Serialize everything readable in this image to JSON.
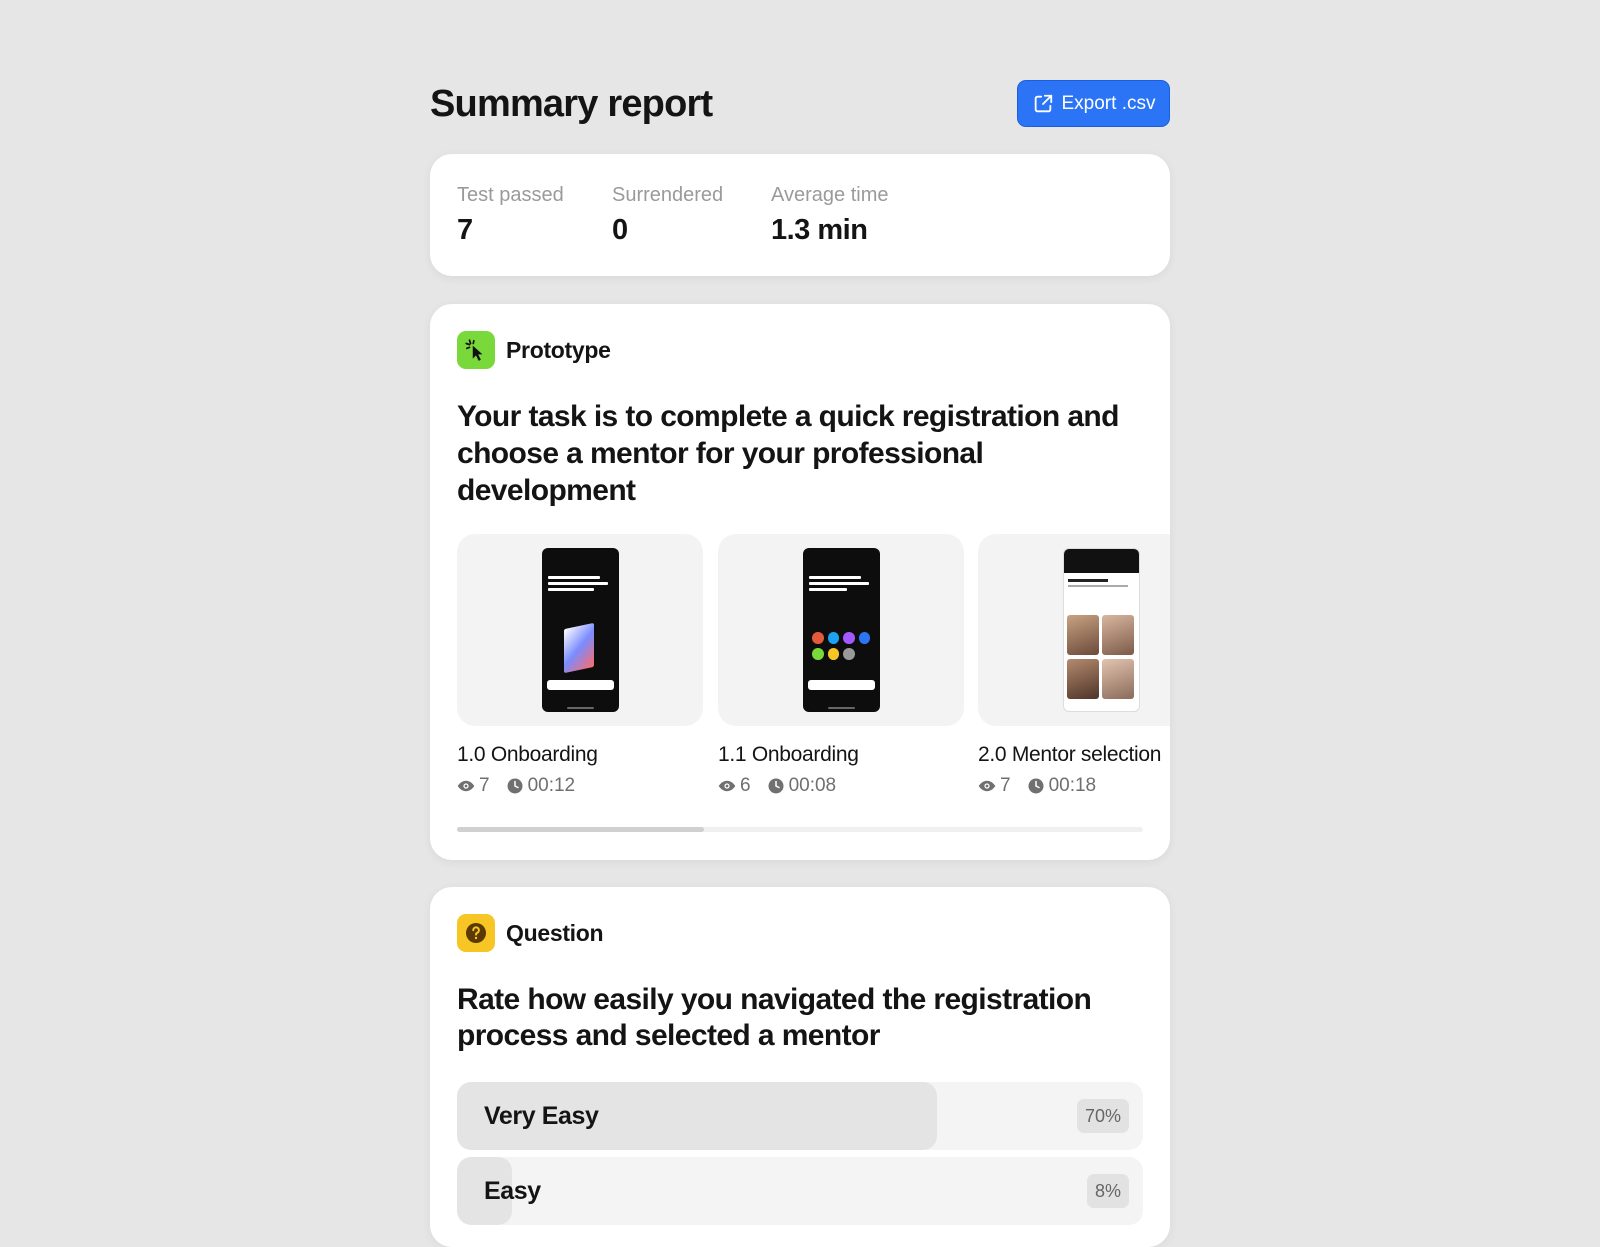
{
  "header": {
    "title": "Summary report",
    "export_label": "Export .csv",
    "export_icon": "share-export-icon",
    "accent": "#2b74f6"
  },
  "stats": [
    {
      "label": "Test passed",
      "value": "7"
    },
    {
      "label": "Surrendered",
      "value": "0"
    },
    {
      "label": "Average time",
      "value": "1.3 min"
    }
  ],
  "prototype": {
    "label": "Prototype",
    "icon": "cursor-click-icon",
    "icon_color": "#7ad93a",
    "task": "Your task is to complete a quick registration and choose a mentor for your professional development",
    "screens": [
      {
        "name": "1.0 Onboarding",
        "views": "7",
        "time": "00:12"
      },
      {
        "name": "1.1 Onboarding",
        "views": "6",
        "time": "00:08"
      },
      {
        "name": "2.0 Mentor selection",
        "views": "7",
        "time": "00:18"
      }
    ]
  },
  "question": {
    "label": "Question",
    "icon": "question-mark-icon",
    "icon_color": "#f8c624",
    "title": "Rate how easily you navigated the registration process and selected a mentor",
    "options": [
      {
        "label": "Very Easy",
        "percent": "70%",
        "fraction": 0.7
      },
      {
        "label": "Easy",
        "percent": "8%",
        "fraction": 0.08
      }
    ]
  }
}
